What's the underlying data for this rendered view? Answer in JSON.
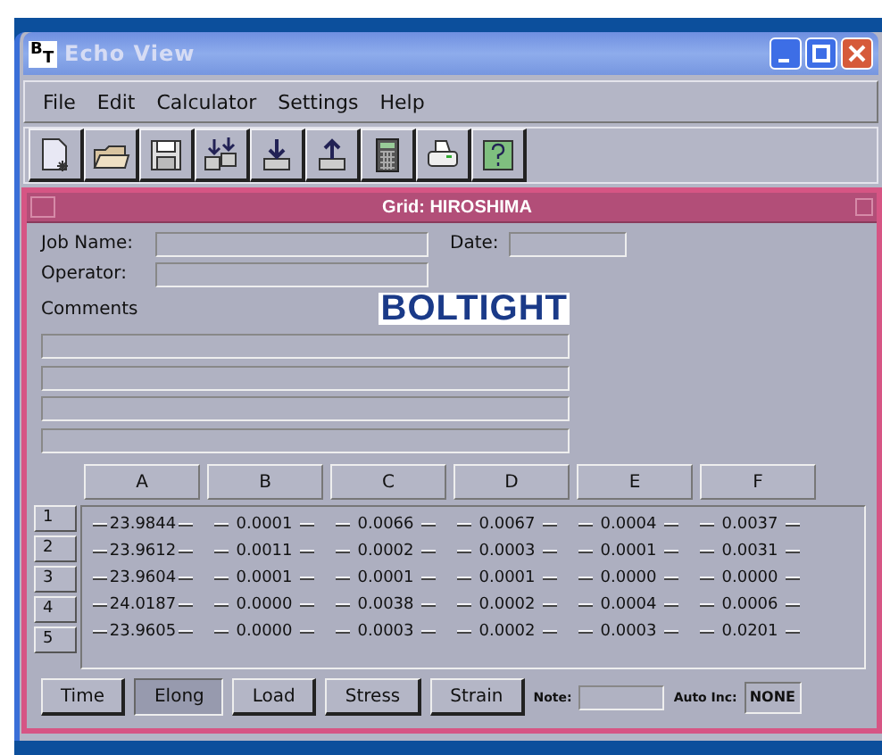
{
  "window": {
    "icon_letters": [
      "B",
      "T"
    ],
    "title": "Echo View"
  },
  "menu": [
    "File",
    "Edit",
    "Calculator",
    "Settings",
    "Help"
  ],
  "grid_window": {
    "title": "Grid: HIROSHIMA"
  },
  "form": {
    "job_name_label": "Job Name:",
    "date_label": "Date:",
    "operator_label": "Operator:",
    "comments_label": "Comments",
    "logo": "BOLTIGHT"
  },
  "table": {
    "columns": [
      "A",
      "B",
      "C",
      "D",
      "E",
      "F"
    ],
    "rows": [
      {
        "label": "1",
        "cells": [
          "23.9844",
          "0.0001",
          "0.0066",
          "0.0067",
          "0.0004",
          "0.0037"
        ]
      },
      {
        "label": "2",
        "cells": [
          "23.9612",
          "0.0011",
          "0.0002",
          "0.0003",
          "0.0001",
          "0.0031"
        ]
      },
      {
        "label": "3",
        "cells": [
          "23.9604",
          "0.0001",
          "0.0001",
          "0.0001",
          "0.0000",
          "0.0000"
        ]
      },
      {
        "label": "4",
        "cells": [
          "24.0187",
          "0.0000",
          "0.0038",
          "0.0002",
          "0.0004",
          "0.0006"
        ]
      },
      {
        "label": "5",
        "cells": [
          "23.9605",
          "0.0000",
          "0.0003",
          "0.0002",
          "0.0003",
          "0.0201"
        ]
      }
    ]
  },
  "measure_buttons": [
    {
      "label": "Time",
      "selected": false
    },
    {
      "label": "Elong",
      "selected": true
    },
    {
      "label": "Load",
      "selected": false
    },
    {
      "label": "Stress",
      "selected": false
    },
    {
      "label": "Strain",
      "selected": false
    }
  ],
  "footer": {
    "note_label": "Note:",
    "auto_inc_label": "Auto Inc:",
    "auto_inc_value": "NONE"
  }
}
